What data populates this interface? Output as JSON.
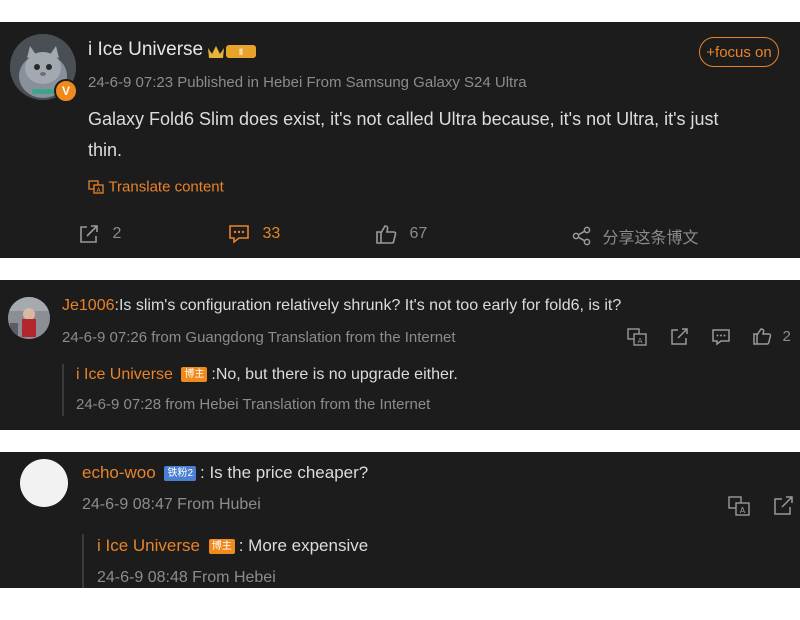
{
  "post": {
    "author": "i Ice Universe",
    "meta": "24-6-9 07:23  Published in Hebei  From Samsung Galaxy S24 Ultra",
    "focus_label": "+focus on",
    "text_line1": "Galaxy Fold6 Slim does exist, it's not called Ultra because, it's not Ultra, it's just",
    "text_line2": "thin.",
    "translate_label": "Translate content",
    "reposts": "2",
    "comments": "33",
    "likes": "67",
    "share_label": "分享这条博文"
  },
  "comment1": {
    "user": "Je1006",
    "text": ":Is slim's configuration relatively shrunk? It's not too early for fold6, is it?",
    "meta": "24-6-9 07:26 from Guangdong Translation from the Internet",
    "likes": "2",
    "reply": {
      "user": "i Ice Universe",
      "badge": "博主",
      "text": ":No, but there is no upgrade either.",
      "meta": "24-6-9 07:28 from Hebei Translation from the Internet"
    }
  },
  "comment2": {
    "user": "echo-woo",
    "badge": "铁粉2",
    "text": ": Is the price cheaper?",
    "meta": "24-6-9 08:47 From Hubei",
    "reply": {
      "user": "i Ice Universe",
      "badge": "博主",
      "text": ": More expensive",
      "meta": "24-6-9 08:48 From Hebei"
    }
  },
  "colors": {
    "accent": "#e8832a",
    "panel": "#1c1c1c",
    "text": "#dcdcdc",
    "muted": "#8c8c8c"
  }
}
